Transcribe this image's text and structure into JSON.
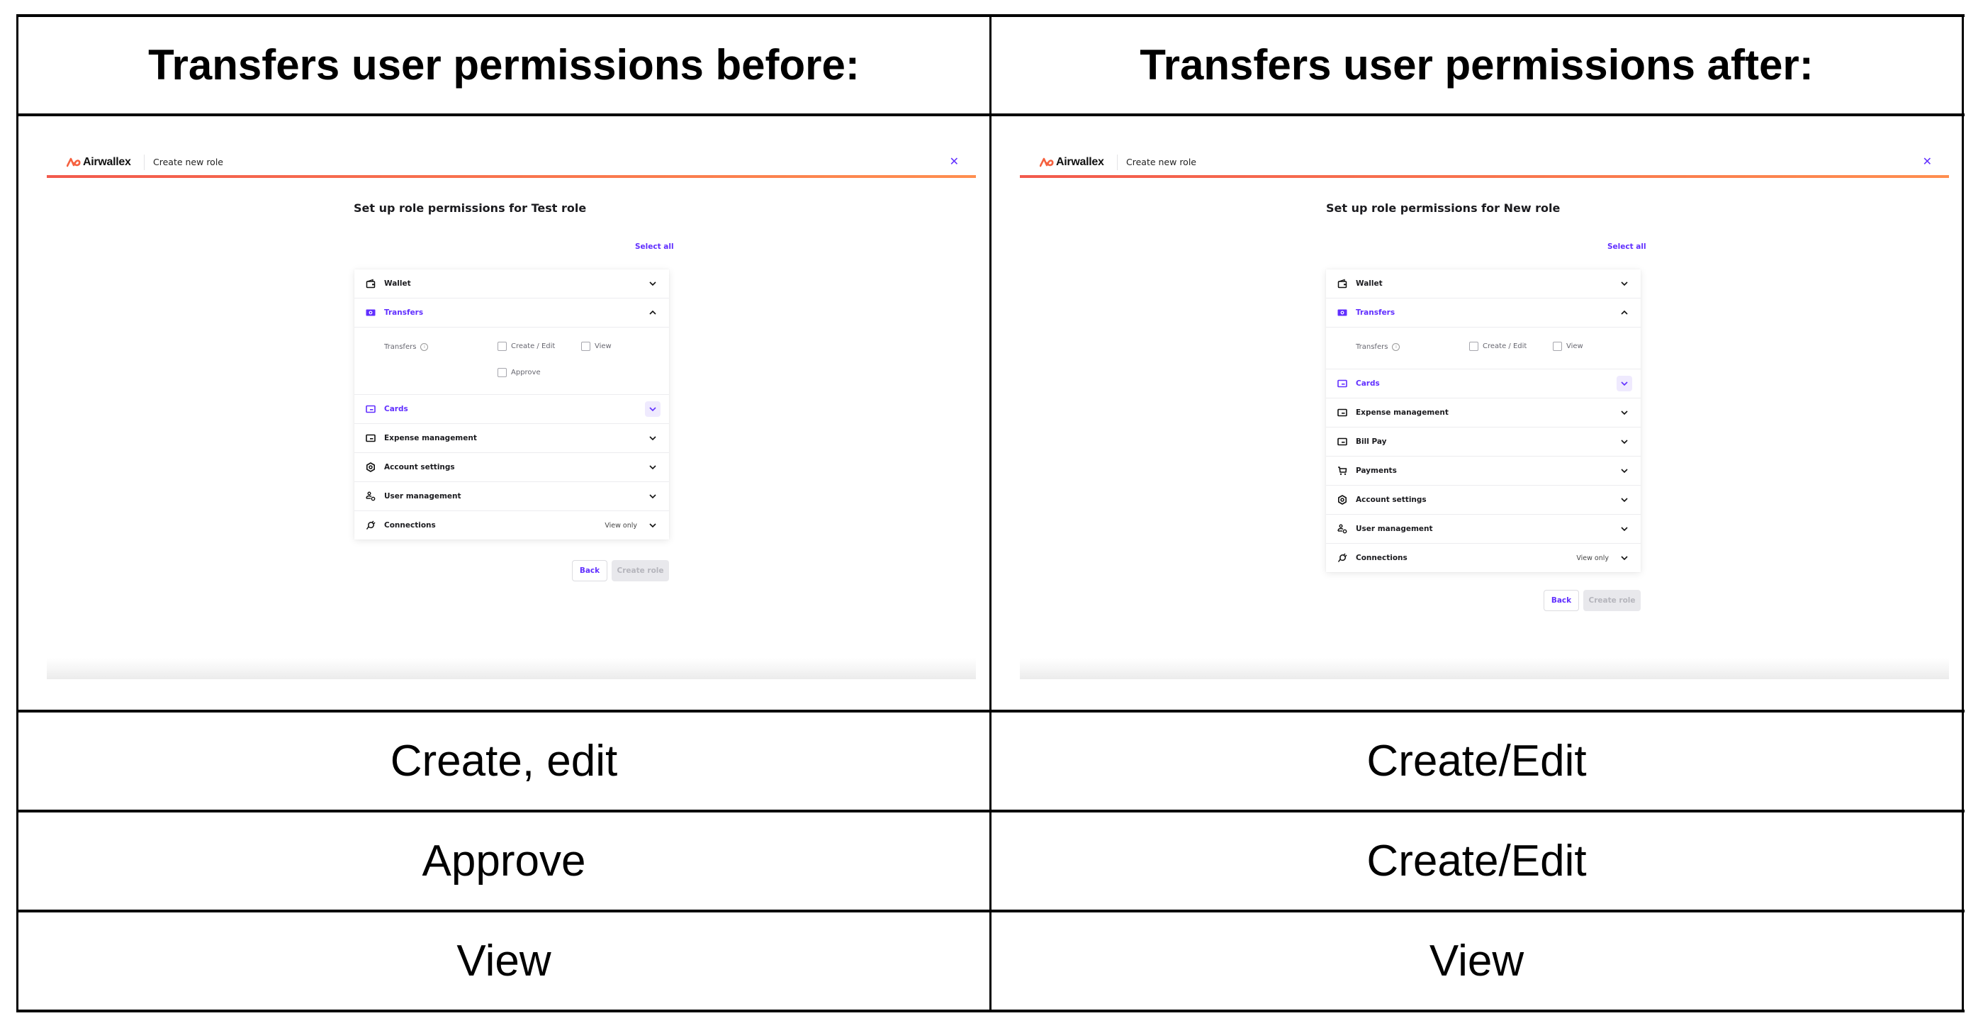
{
  "table": {
    "headers": [
      "Transfers user permissions before:",
      "Transfers user permissions after:"
    ],
    "rows": [
      [
        "Create, edit",
        "Create/Edit"
      ],
      [
        "Approve",
        "Create/Edit"
      ],
      [
        "View",
        "View"
      ]
    ]
  },
  "before": {
    "brand": "Airwallex",
    "bar_title": "Create new role",
    "close_icon": "close-icon",
    "page_title": "Set up role permissions for Test role",
    "select_all": "Select all",
    "sections": [
      {
        "label": "Wallet",
        "icon": "wallet-icon",
        "state": "collapsed",
        "active": false
      },
      {
        "label": "Transfers",
        "icon": "transfers-icon",
        "state": "expanded",
        "active": true
      },
      {
        "label": "Cards",
        "icon": "card-icon",
        "state": "collapsed",
        "active": true,
        "hover": true
      },
      {
        "label": "Expense management",
        "icon": "expense-icon",
        "state": "collapsed",
        "active": false
      },
      {
        "label": "Account settings",
        "icon": "settings-gear-icon",
        "state": "collapsed",
        "active": false
      },
      {
        "label": "User management",
        "icon": "user-management-icon",
        "state": "collapsed",
        "active": false
      },
      {
        "label": "Connections",
        "icon": "plug-icon",
        "state": "collapsed",
        "active": false,
        "aside": "View only"
      }
    ],
    "transfers_permissions": {
      "label": "Transfers",
      "options": [
        {
          "label": "Create / Edit",
          "checked": false
        },
        {
          "label": "View",
          "checked": false
        },
        {
          "label": "Approve",
          "checked": false
        }
      ]
    },
    "back_label": "Back",
    "create_label": "Create role"
  },
  "after": {
    "brand": "Airwallex",
    "bar_title": "Create new role",
    "close_icon": "close-icon",
    "page_title": "Set up role permissions for New role",
    "select_all": "Select all",
    "sections": [
      {
        "label": "Wallet",
        "icon": "wallet-icon",
        "state": "collapsed",
        "active": false
      },
      {
        "label": "Transfers",
        "icon": "transfers-icon",
        "state": "expanded",
        "active": true
      },
      {
        "label": "Cards",
        "icon": "card-icon",
        "state": "collapsed",
        "active": true,
        "hover": true
      },
      {
        "label": "Expense management",
        "icon": "expense-icon",
        "state": "collapsed",
        "active": false
      },
      {
        "label": "Bill Pay",
        "icon": "bill-pay-icon",
        "state": "collapsed",
        "active": false
      },
      {
        "label": "Payments",
        "icon": "cart-icon",
        "state": "collapsed",
        "active": false
      },
      {
        "label": "Account settings",
        "icon": "settings-gear-icon",
        "state": "collapsed",
        "active": false
      },
      {
        "label": "User management",
        "icon": "user-management-icon",
        "state": "collapsed",
        "active": false
      },
      {
        "label": "Connections",
        "icon": "plug-icon",
        "state": "collapsed",
        "active": false,
        "aside": "View only"
      }
    ],
    "transfers_permissions": {
      "label": "Transfers",
      "options": [
        {
          "label": "Create / Edit",
          "checked": false
        },
        {
          "label": "View",
          "checked": false
        }
      ]
    },
    "back_label": "Back",
    "create_label": "Create role"
  },
  "colors": {
    "accent_purple": "#612fff",
    "brand_gradient_start": "#f25a4d",
    "brand_gradient_end": "#ff8e4f",
    "table_border": "#000000"
  }
}
